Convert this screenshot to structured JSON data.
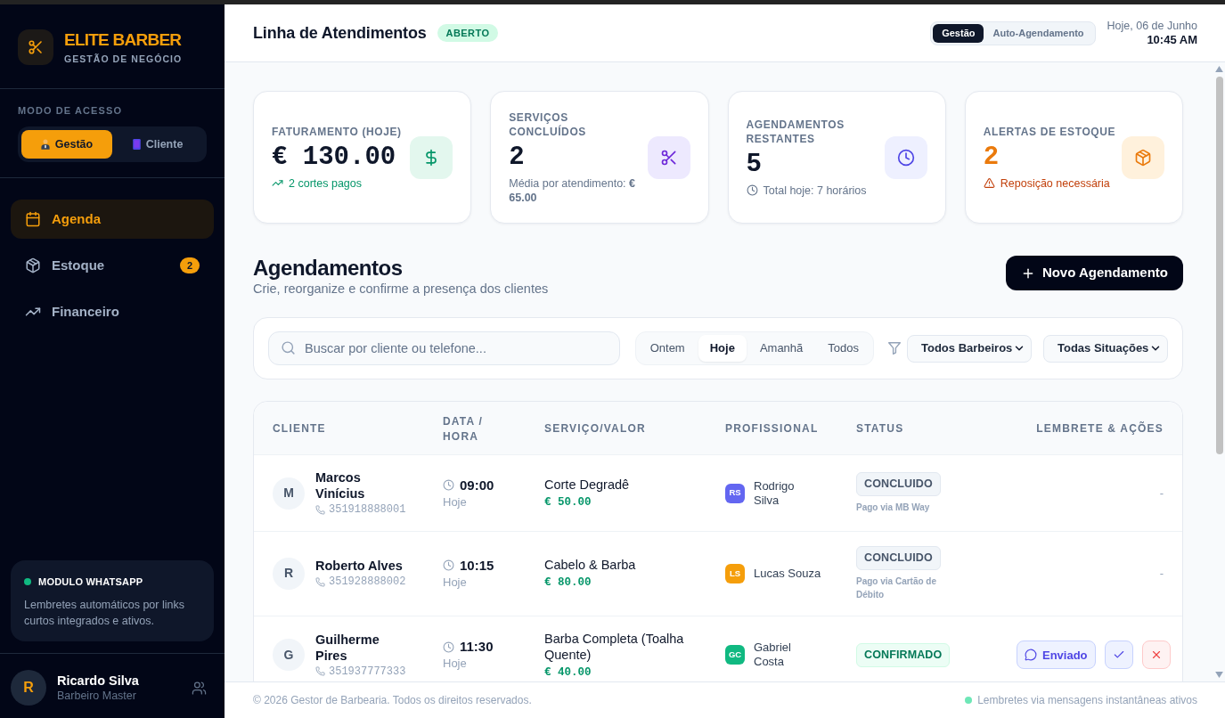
{
  "sidebar": {
    "brand": {
      "title": "ELITE BARBER",
      "subtitle": "GESTÃO DE NEGÓCIO"
    },
    "access_mode": {
      "label": "MODO DE ACESSO",
      "options": [
        {
          "label": "Gestão",
          "selected": true
        },
        {
          "label": "Cliente",
          "selected": false
        }
      ]
    },
    "nav": [
      {
        "label": "Agenda",
        "selected": true
      },
      {
        "label": "Estoque",
        "selected": false,
        "badge": "2"
      },
      {
        "label": "Financeiro",
        "selected": false
      }
    ],
    "whatsapp_card": {
      "title": "MODULO WHATSAPP",
      "text": "Lembretes automáticos por links curtos integrados e ativos."
    },
    "user": {
      "initial": "R",
      "name": "Ricardo Silva",
      "role": "Barbeiro Master"
    }
  },
  "header": {
    "title": "Linha de Atendimentos",
    "status_badge": "ABERTO",
    "mode_tabs": [
      {
        "label": "Gestão",
        "selected": true
      },
      {
        "label": "Auto-Agendamento",
        "selected": false
      }
    ],
    "date": "Hoje, 06 de Junho",
    "time": "10:45 AM"
  },
  "stats": [
    {
      "kind": "revenue",
      "label": "FATURAMENTO (HOJE)",
      "value": "€ 130.00",
      "note": "2 cortes pagos"
    },
    {
      "kind": "services",
      "label": "SERVIÇOS CONCLUÍDOS",
      "value": "2",
      "note": "Média por atendimento: **€ 65.00**"
    },
    {
      "kind": "appointments",
      "label": "AGENDAMENTOS RESTANTES",
      "value": "5",
      "note": "Total hoje: 7 horários"
    },
    {
      "kind": "stock",
      "label": "ALERTAS DE ESTOQUE",
      "value": "2",
      "note": "Reposição necessária"
    }
  ],
  "appointments": {
    "title": "Agendamentos",
    "subtitle": "Crie, reorganize e confirme a presença dos clientes",
    "new_button": "Novo Agendamento",
    "filters": {
      "search_placeholder": "Buscar por cliente ou telefone...",
      "day_tabs": [
        {
          "label": "Ontem",
          "selected": false
        },
        {
          "label": "Hoje",
          "selected": true
        },
        {
          "label": "Amanhã",
          "selected": false
        },
        {
          "label": "Todos",
          "selected": false
        }
      ],
      "selects": [
        "Todos Barbeiros",
        "Todas Situações"
      ]
    },
    "table": {
      "columns": [
        "CLIENTE",
        "DATA / HORA",
        "SERVIÇO/VALOR",
        "PROFISSIONAL",
        "STATUS",
        "LEMBRETE & AÇÕES"
      ],
      "rows": [
        {
          "initial": "M",
          "name": "Marcos Vinícius",
          "phone": "351918888001",
          "time": "09:00",
          "day": "Hoje",
          "service": "Corte Degradê",
          "price": "€ 50.00",
          "professional": {
            "initials": "RS",
            "name": "Rodrigo Silva",
            "color": "#6366f1"
          },
          "status": {
            "kind": "completed",
            "label": "CONCLUIDO",
            "note": "Pago via MB Way"
          },
          "actions": {
            "kind": "none",
            "text": "-"
          }
        },
        {
          "initial": "R",
          "name": "Roberto Alves",
          "phone": "351928888002",
          "time": "10:15",
          "day": "Hoje",
          "service": "Cabelo & Barba",
          "price": "€ 80.00",
          "professional": {
            "initials": "LS",
            "name": "Lucas Souza",
            "color": "#f59e0b"
          },
          "status": {
            "kind": "completed",
            "label": "CONCLUIDO",
            "note": "Pago via Cartão de Débito"
          },
          "actions": {
            "kind": "none",
            "text": "-"
          }
        },
        {
          "initial": "G",
          "name": "Guilherme Pires",
          "phone": "351937777333",
          "time": "11:30",
          "day": "Hoje",
          "service": "Barba Completa (Toalha Quente)",
          "price": "€ 40.00",
          "professional": {
            "initials": "GC",
            "name": "Gabriel Costa",
            "color": "#10b981"
          },
          "status": {
            "kind": "confirmed",
            "label": "CONFIRMADO"
          },
          "actions": {
            "kind": "reminder",
            "text": "Enviado"
          }
        }
      ]
    }
  },
  "footer": {
    "copyright": "© 2026 Gestor de Barbearia. Todos os direitos reservados.",
    "status": "Lembretes via mensagens instantâneas ativos"
  }
}
